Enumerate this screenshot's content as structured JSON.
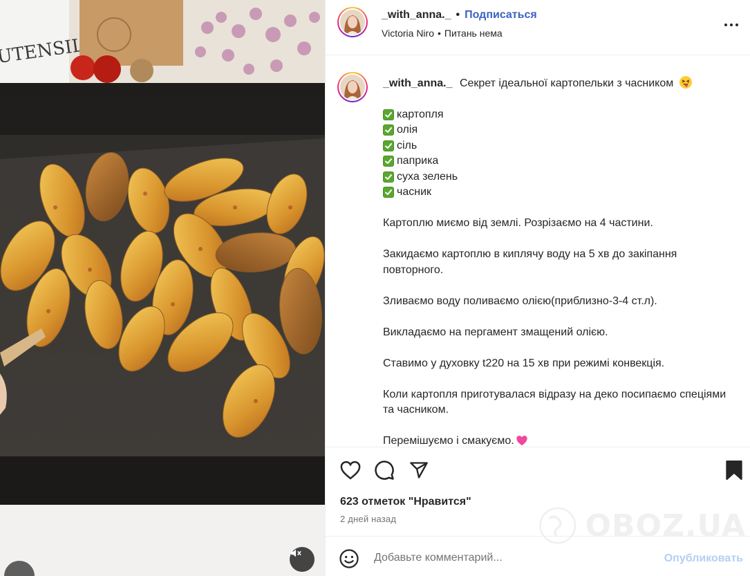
{
  "post": {
    "username": "_with_anna._",
    "follow_label": "Подписаться",
    "separator": "•",
    "audio_artist": "Victoria Niro",
    "audio_track": "Питань нема"
  },
  "caption": {
    "username": "_with_anna._",
    "headline": "Секрет ідеальної картопельки з часником",
    "headline_emoji": "squinting-face-with-tongue",
    "ingredients": [
      "картопля",
      "олія",
      "сіль",
      "паприка",
      "суха зелень",
      "часник"
    ],
    "steps": [
      "Картоплю миємо від землі. Розрізаємо на 4 частини.",
      "Закидаємо картоплю в киплячу воду на 5 хв до закіпання повторного.",
      "Зливаємо воду поливаємо олією(приблизно-3-4 ст.л).",
      "Викладаємо на пергамент змащений олією.",
      "Ставимо у духовку t220 на 15 хв при режимі конвекція.",
      "Коли картопля приготувалася відразу на деко посипаємо спеціями та часником.",
      "Перемішуємо і смакуємо."
    ],
    "closing_emoji": "pink-heart"
  },
  "actions": {
    "likes_text": "623 отметок \"Нравится\"",
    "time_text": "2 дней назад",
    "icons": [
      "heart-icon",
      "comment-icon",
      "share-icon",
      "bookmark-icon"
    ]
  },
  "comment": {
    "placeholder": "Добавьте комментарий...",
    "publish_label": "Опубликовать"
  },
  "watermark": {
    "text": "OBOZ.UA"
  },
  "media": {
    "description_icons": [
      "mute-icon"
    ]
  },
  "colors": {
    "link": "#3a63c0",
    "publish_disabled": "#b2cff5",
    "secondary_text": "#737373",
    "check_green": "#5aa72f"
  }
}
